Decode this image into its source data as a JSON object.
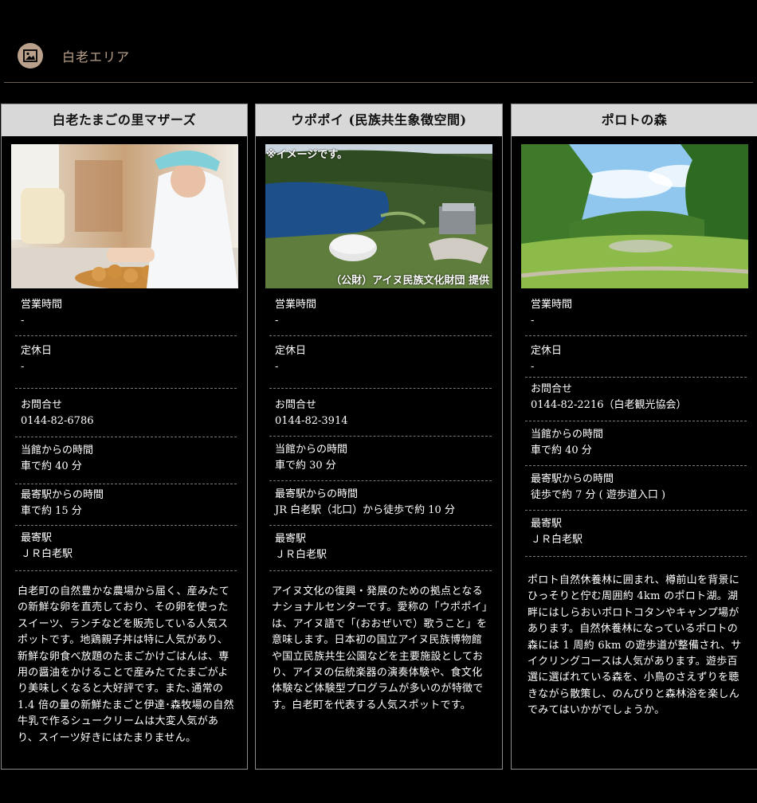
{
  "header": {
    "title": "白老エリア",
    "icon": "image-icon",
    "accent": "#b9a18c"
  },
  "cards": [
    {
      "title": "白老たまごの里マザーズ",
      "rows": [
        {
          "label": "営業時間",
          "value": "-"
        },
        {
          "label": "定休日",
          "value": "-"
        },
        {
          "label": "お問合せ",
          "value": "0144-82-6786"
        },
        {
          "label": "当館からの時間",
          "value": "車で約 40 分"
        },
        {
          "label": "最寄駅からの時間",
          "value": "車で約 15 分"
        },
        {
          "label": "最寄駅",
          "value": "ＪＲ白老駅"
        }
      ],
      "description": "白老町の自然豊かな農場から届く、産みたての新鮮な卵を直売しており、その卵を使ったスイーツ、ランチなどを販売している人気スポットです。地鶏親子丼は特に人気があり、新鮮な卵食べ放題のたまごかけごはんは、専用の醤油をかけることで産みたてたまごがより美味しくなると大好評です。また､通常の 1.4 倍の量の新鮮たまごと伊達･森牧場の自然牛乳で作るシュークリームは大変人気があり、スイーツ好きにはたまりません。"
    },
    {
      "title": "ウポポイ (民族共生象徴空間)",
      "overlay_top": "※イメージです。",
      "overlay_bottom": "（公財）アイヌ民族文化財団 提供",
      "rows": [
        {
          "label": "営業時間",
          "value": "-"
        },
        {
          "label": "定休日",
          "value": "-"
        },
        {
          "label": "お問合せ",
          "value": "0144-82-3914"
        },
        {
          "label": "当館からの時間",
          "value": "車で約 30 分"
        },
        {
          "label": "最寄駅からの時間",
          "value": "JR 白老駅（北口）から徒歩で約 10 分"
        },
        {
          "label": "最寄駅",
          "value": "ＪＲ白老駅"
        }
      ],
      "description": "アイヌ文化の復興・発展のための拠点となるナショナルセンターです。愛称の「ウポポイ」は、アイヌ語で「(おおぜいで）歌うこと」を意味します。日本初の国立アイヌ民族博物館や国立民族共生公園などを主要施設としており、アイヌの伝統楽器の演奏体験や、食文化体験など体験型プログラムが多いのが特徴です。白老町を代表する人気スポットです。"
    },
    {
      "title": "ポロトの森",
      "rows": [
        {
          "label": "営業時間",
          "value": " -"
        },
        {
          "label": "定休日",
          "value": "-"
        },
        {
          "label": "お問合せ",
          "value": "0144-82-2216（白老観光協会）"
        },
        {
          "label": "当館からの時間",
          "value": "車で約 40 分"
        },
        {
          "label": "最寄駅からの時間",
          "value": "徒歩で約 7 分 ( 遊歩道入口 )"
        },
        {
          "label": "最寄駅",
          "value": "ＪＲ白老駅"
        }
      ],
      "description": "ポロト自然休養林に囲まれ、樽前山を背景にひっそりと佇む周囲約 4km のポロト湖。湖畔にはしらおいポロトコタンやキャンプ場があります。自然休養林になっているポロトの森には 1 周約 6km の遊歩道が整備され、サイクリングコースは人気があります。遊歩百選に選ばれている森を、小鳥のさえずりを聴きながら散策し、のんびりと森林浴を楽しんでみてはいかがでしょうか。"
    }
  ]
}
